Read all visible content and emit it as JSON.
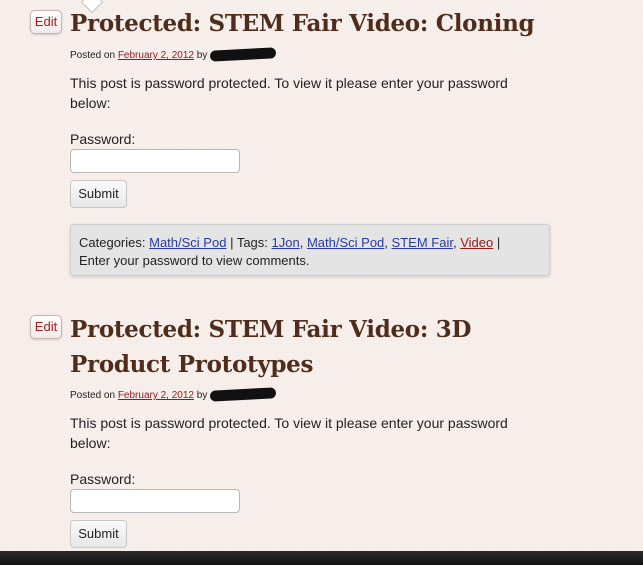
{
  "posts": [
    {
      "edit_label": "Edit",
      "title": "Protected: STEM Fair Video: Cloning",
      "posted_on": "Posted on",
      "date": "February 2, 2012",
      "by": "by",
      "message": "This post is password protected. To view it please enter your password below:",
      "password_label": "Password:",
      "submit_label": "Submit",
      "categories_label": "Categories:",
      "category": "Math/Sci Pod",
      "tags_label": "| Tags:",
      "tags": [
        "1Jon",
        "Math/Sci Pod",
        "STEM Fair",
        "Video"
      ],
      "comments_note": "Enter your password to view comments."
    },
    {
      "edit_label": "Edit",
      "title": "Protected: STEM Fair Video: 3D Product Prototypes",
      "posted_on": "Posted on",
      "date": "February 2, 2012",
      "by": "by",
      "message": "This post is password protected. To view it please enter your password below:",
      "password_label": "Password:",
      "submit_label": "Submit"
    }
  ],
  "separators": {
    "comma": ",",
    "pipe": "|"
  },
  "colors": {
    "title": "#4f2d1c",
    "link": "#2a3aa0",
    "visited_link": "#8e1a1a",
    "edit": "#b0191a"
  }
}
